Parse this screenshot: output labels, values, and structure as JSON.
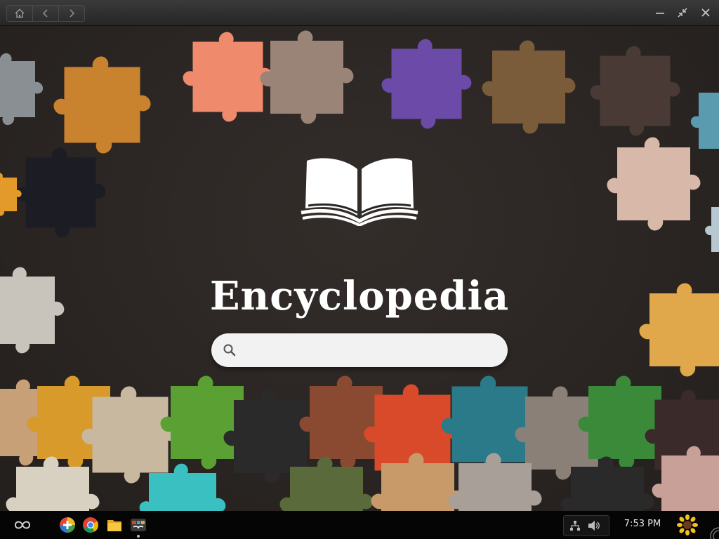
{
  "window": {
    "nav": {
      "home_icon": "home-icon",
      "back_icon": "back-arrow-icon",
      "forward_icon": "forward-arrow-icon"
    },
    "controls": [
      "minimize-icon",
      "unmaximize-icon",
      "close-icon"
    ]
  },
  "app": {
    "title": "Encyclopedia",
    "logo_icon": "open-book-icon",
    "search": {
      "value": "",
      "placeholder": ""
    }
  },
  "taskbar": {
    "launcher_icon": "endless-infinity-icon",
    "apps": [
      "app-store-icon",
      "chrome-browser-icon",
      "file-manager-icon",
      "encyclopedia-app-icon"
    ],
    "tray": [
      "network-icon",
      "volume-icon"
    ],
    "clock": "7:53 PM",
    "user_icon": "sunflower-avatar-icon"
  },
  "colors": {
    "background": "#2a2523",
    "titlebar": "#2e2e2e",
    "taskbar": "#050505",
    "search_bg": "#f2f2f2",
    "title_text": "#ffffff"
  }
}
